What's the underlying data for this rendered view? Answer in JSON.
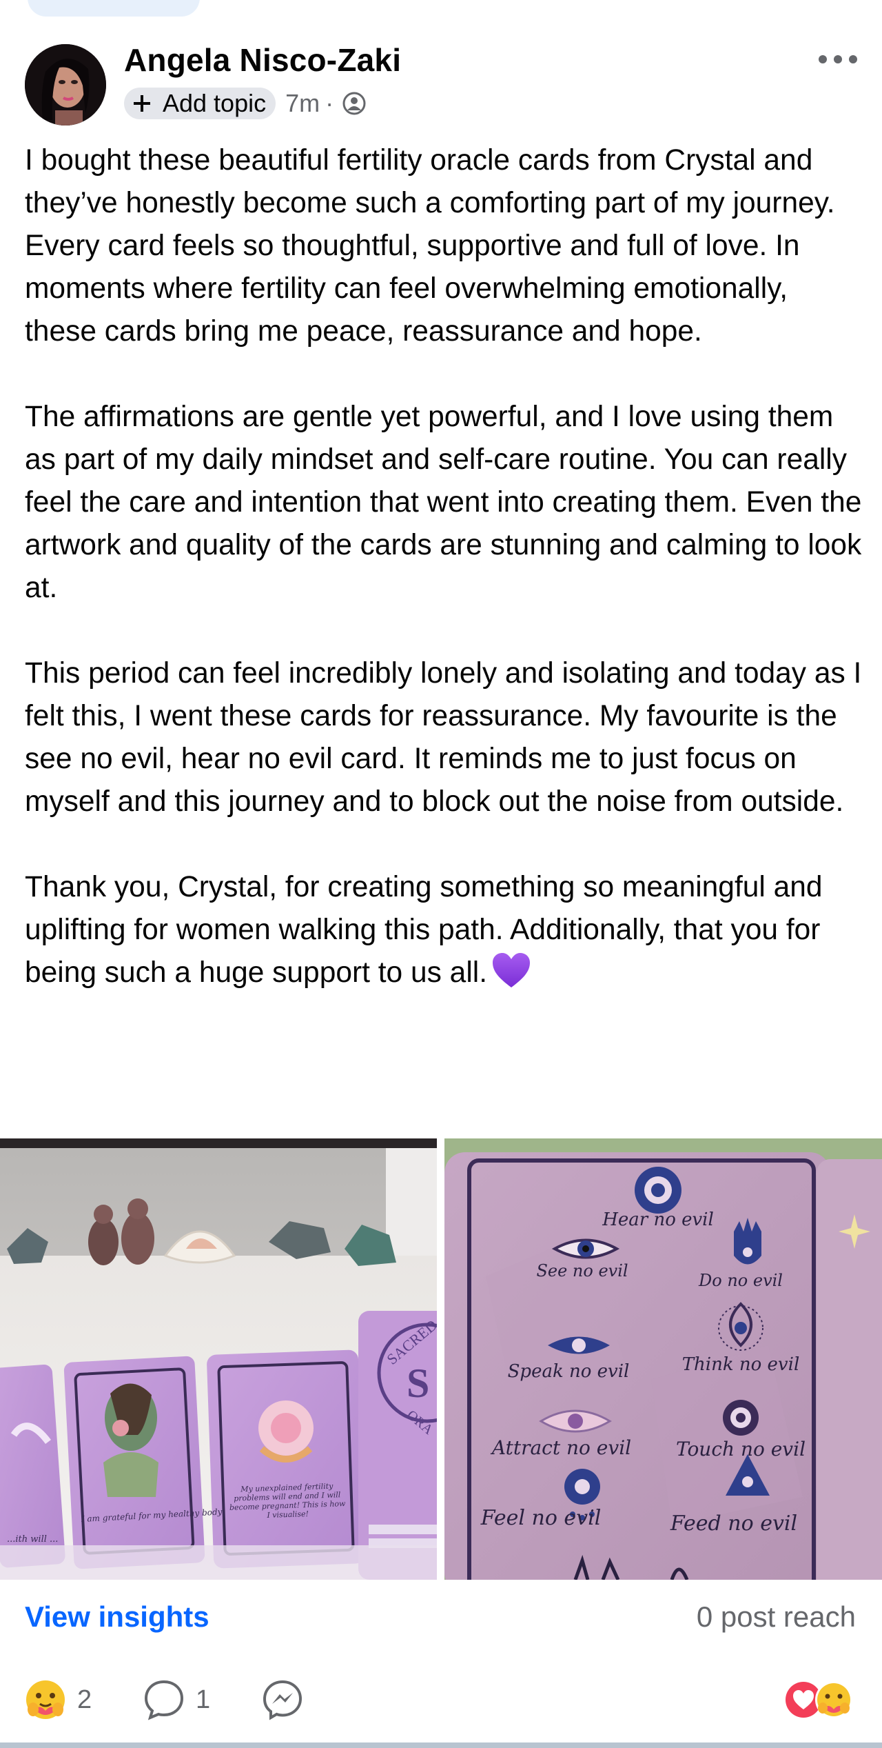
{
  "post": {
    "author": "Angela Nisco-Zaki",
    "add_topic_label": "Add topic",
    "timestamp": "7m",
    "separator": "·",
    "audience_icon": "friends-icon",
    "more_icon": "more-horizontal-icon",
    "paragraphs": [
      "I bought these beautiful fertility oracle cards from Crystal and they’ve honestly become such a comforting part of my journey. Every card feels so thoughtful, supportive and full of love. In moments where fertility can feel overwhelming emotionally, these cards bring me peace, reassurance and hope.",
      "The affirmations are gentle yet powerful, and I love using them as part of my daily mindset and self-care routine. You can really feel the care and intention that went into creating them. Even the artwork and quality of the cards are stunning and calming to look at.",
      "This period can feel incredibly lonely and isolating and today as I felt this, I went these cards for reassurance. My favourite is the see no evil, hear no evil card. It reminds me to just focus on myself and this journey and to block out the noise from outside.",
      "Thank you, Crystal, for creating something so meaningful and uplifting for women walking this path. Additionally, that you for being such a huge support to us all."
    ],
    "emoji": "purple-heart"
  },
  "photos": {
    "left": {
      "box_text_1": "SACRED",
      "box_text_2": "S",
      "box_text_3": "ORA",
      "card_a": "...ith will ...",
      "card_b": "I am grateful for my healthy body",
      "card_c": "My unexplained fertility problems will end and I will become pregnant! This is how I visualise!"
    },
    "right": {
      "items": [
        "Hear no evil",
        "See no evil",
        "Do no evil",
        "Speak no evil",
        "Think no evil",
        "Attract no evil",
        "Touch no evil",
        "Feel no evil",
        "Feed no evil"
      ]
    }
  },
  "insights": {
    "link_label": "View insights",
    "reach_label": "0 post reach"
  },
  "actions": {
    "reaction_count": "2",
    "comment_count": "1",
    "reaction_icon": "care-emoji-icon",
    "comment_icon": "comment-icon",
    "share_icon": "messenger-icon",
    "summary_icons": [
      "love-icon",
      "care-icon"
    ]
  },
  "colors": {
    "link": "#0866ff",
    "secondary_text": "#65676b",
    "card_purple": "#c8a6d6"
  }
}
